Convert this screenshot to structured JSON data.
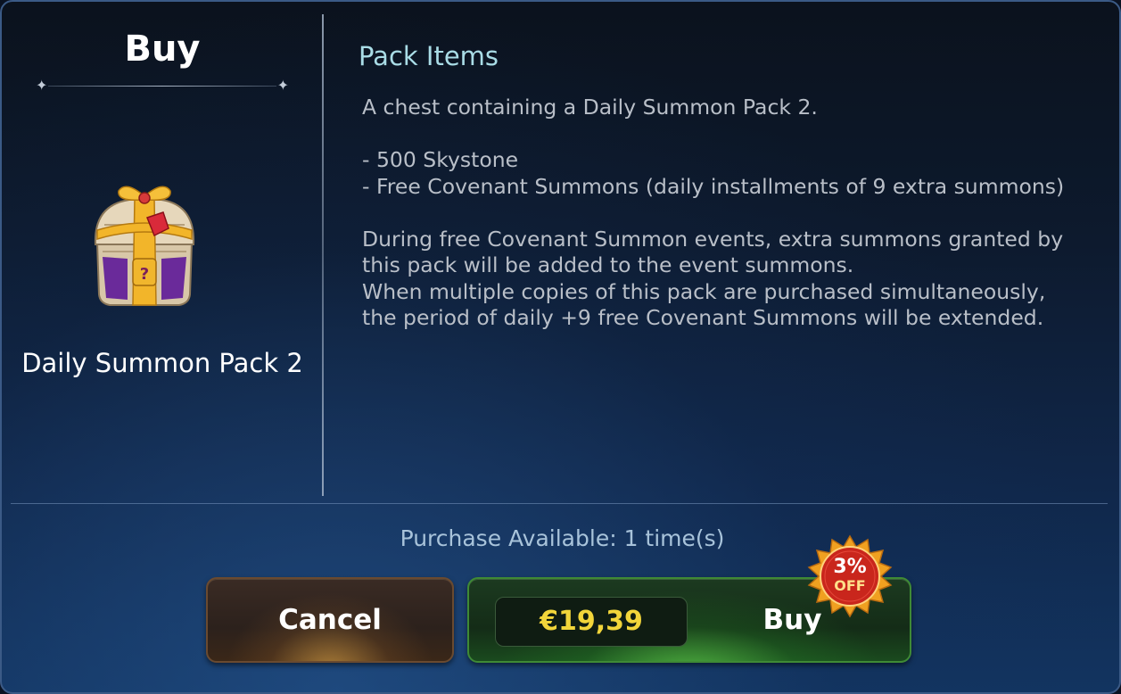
{
  "left": {
    "title": "Buy",
    "pack_name": "Daily Summon Pack 2",
    "icon": "treasure-chest-icon"
  },
  "right": {
    "heading": "Pack Items",
    "lines": {
      "l1": "A chest containing a Daily Summon Pack 2.",
      "l2": "- 500 Skystone",
      "l3": "- Free Covenant Summons (daily installments of 9 extra summons)",
      "l4": "During free Covenant Summon events, extra summons granted by",
      "l5": "this pack will be added to the event summons.",
      "l6": "When multiple copies of this pack are purchased simultaneously,",
      "l7": "the period of daily +9 free Covenant Summons will be extended."
    }
  },
  "footer": {
    "availability": "Purchase Available: 1 time(s)",
    "cancel_label": "Cancel",
    "price": "€19,39",
    "buy_label": "Buy",
    "discount_pct": "3%",
    "discount_off": "OFF"
  },
  "colors": {
    "accent_heading": "#a9dce6",
    "price": "#f2d53a",
    "buy_green": "#3f8a35",
    "discount_red": "#c9261c"
  }
}
